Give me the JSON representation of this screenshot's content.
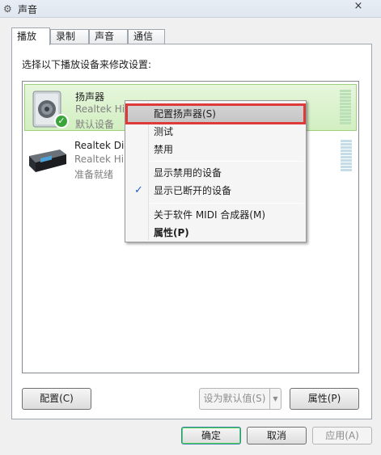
{
  "window": {
    "title": "声音",
    "close_glyph": "×"
  },
  "tabs": [
    {
      "label": "播放",
      "active": true
    },
    {
      "label": "录制",
      "active": false
    },
    {
      "label": "声音",
      "active": false
    },
    {
      "label": "通信",
      "active": false
    }
  ],
  "instruction": "选择以下播放设备来修改设置:",
  "devices": [
    {
      "name": "扬声器",
      "description": "Realtek Hi",
      "status": "默认设备",
      "icon": "speaker-icon",
      "selected": true,
      "default_check": true
    },
    {
      "name": "Realtek Dig",
      "description": "Realtek Hi",
      "status": "准备就绪",
      "icon": "digital-output-icon",
      "selected": false
    }
  ],
  "context_menu": {
    "items": [
      {
        "label": "配置扬声器(S)",
        "highlighted": true
      },
      {
        "label": "测试"
      },
      {
        "label": "禁用"
      },
      {
        "label": "显示禁用的设备"
      },
      {
        "label": "显示已断开的设备",
        "checked": true
      },
      {
        "label": "关于软件 MIDI 合成器(M)"
      },
      {
        "label": "属性(P)",
        "bold": true
      }
    ]
  },
  "panel_buttons": {
    "configure": "配置(C)",
    "set_default": "设为默认值(S)",
    "properties": "属性(P)"
  },
  "dialog_buttons": {
    "ok": "确定",
    "cancel": "取消",
    "apply": "应用(A)"
  },
  "colors": {
    "selected_bg": "#d2efc1",
    "highlight_outline": "#dd3a3a",
    "default_check": "#3aa53a"
  }
}
